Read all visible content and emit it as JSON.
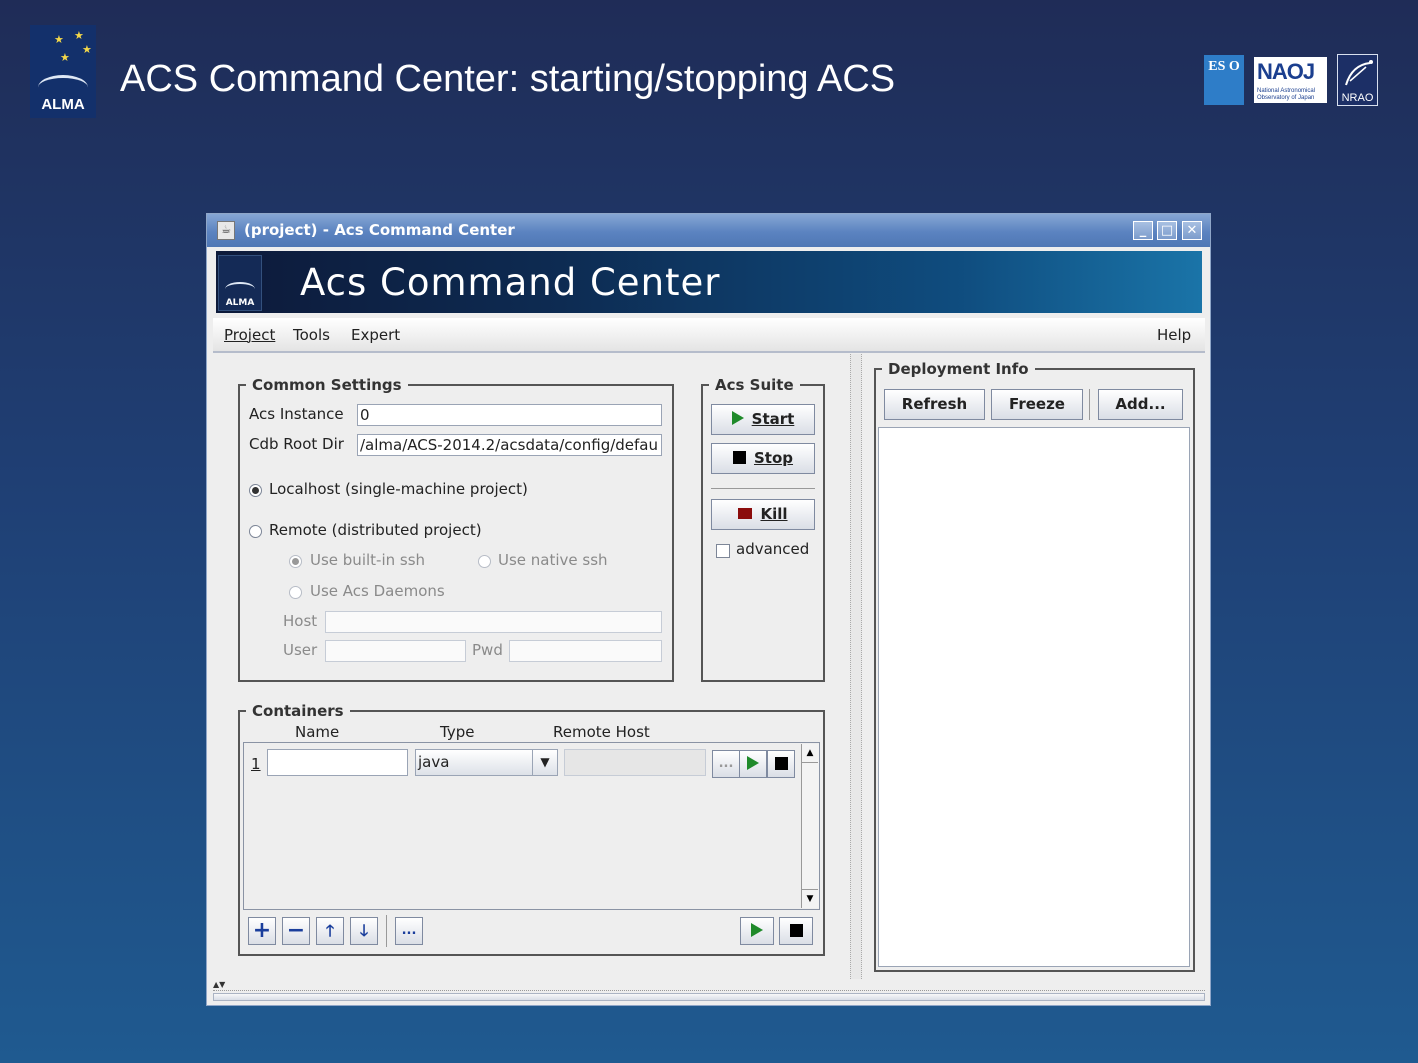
{
  "slide": {
    "title": "ACS Command Center: starting/stopping ACS",
    "alma_logo_text": "ALMA",
    "eso_logo_text": "ES O",
    "naoj_logo_text": "NAOJ",
    "naoj_logo_subtext": "National Astronomical Observatory of Japan",
    "nrao_logo_text": "NRAO"
  },
  "window": {
    "title": "(project) - Acs Command Center",
    "controls": [
      "_",
      "□",
      "✕"
    ]
  },
  "banner": {
    "title": "Acs Command Center",
    "logo_text": "ALMA"
  },
  "menu": {
    "project": "Project",
    "tools": "Tools",
    "expert": "Expert",
    "help": "Help"
  },
  "common_settings": {
    "legend": "Common Settings",
    "acs_instance_label": "Acs Instance",
    "acs_instance_value": "0",
    "cdb_root_label": "Cdb Root Dir",
    "cdb_root_value": "/alma/ACS-2014.2/acsdata/config/defau",
    "localhost_label": "Localhost (single-machine project)",
    "remote_label": "Remote (distributed project)",
    "builtin_ssh_label": "Use built-in ssh",
    "native_ssh_label": "Use native ssh",
    "daemons_label": "Use Acs Daemons",
    "host_label": "Host",
    "user_label": "User",
    "pwd_label": "Pwd",
    "selected_mode": "localhost"
  },
  "acs_suite": {
    "legend": "Acs Suite",
    "start_label": "Start",
    "stop_label": "Stop",
    "kill_label": "Kill",
    "advanced_label": "advanced",
    "advanced_checked": false
  },
  "containers": {
    "legend": "Containers",
    "columns": [
      "Name",
      "Type",
      "Remote Host"
    ],
    "rows": [
      {
        "index": "1",
        "name": "",
        "type": "java",
        "remote_host": "",
        "more": "..."
      }
    ],
    "toolbar_more": "..."
  },
  "deployment": {
    "legend": "Deployment Info",
    "refresh_label": "Refresh",
    "freeze_label": "Freeze",
    "add_label": "Add..."
  },
  "colors": {
    "play_green": "#1f8a2a",
    "kill_red": "#8b0c0c",
    "titlebar_blue": "#5b83c0"
  }
}
